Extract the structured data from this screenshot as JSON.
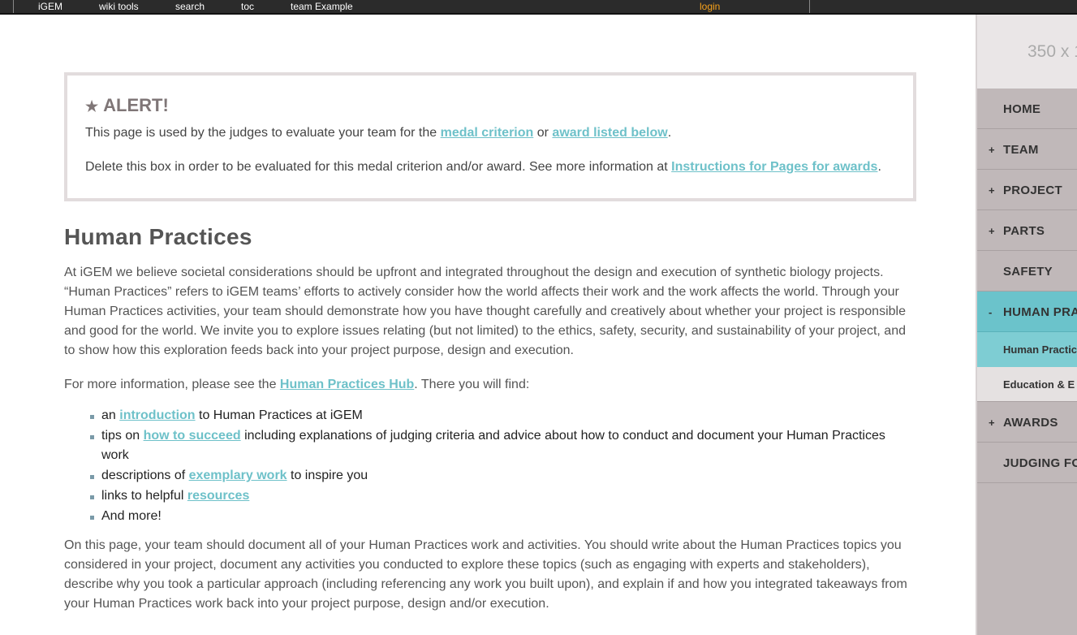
{
  "topbar": {
    "igem": "iGEM",
    "wiki_tools": "wiki tools",
    "search": "search",
    "toc": "toc",
    "team": "team Example",
    "login": "login"
  },
  "sidebar": {
    "logo_placeholder": "350 x 1",
    "items": [
      {
        "sign": "",
        "label": "HOME"
      },
      {
        "sign": "+",
        "label": "TEAM"
      },
      {
        "sign": "+",
        "label": "PROJECT"
      },
      {
        "sign": "+",
        "label": "PARTS"
      },
      {
        "sign": "",
        "label": "SAFETY"
      },
      {
        "sign": "-",
        "label": "HUMAN PRA"
      }
    ],
    "sub_items": [
      "Human Practic",
      "Education & E"
    ],
    "items_after": [
      {
        "sign": "+",
        "label": "AWARDS"
      },
      {
        "sign": "",
        "label": "JUDGING FO"
      }
    ]
  },
  "alert": {
    "star": "★",
    "title": "ALERT!",
    "p1_pre": "This page is used by the judges to evaluate your team for the ",
    "p1_link1": "medal criterion",
    "p1_mid": " or ",
    "p1_link2": "award listed below",
    "p1_post": ".",
    "p2_pre": "Delete this box in order to be evaluated for this medal criterion and/or award. See more information at ",
    "p2_link": "Instructions for Pages for awards",
    "p2_post": "."
  },
  "main": {
    "title": "Human Practices",
    "intro": "At iGEM we believe societal considerations should be upfront and integrated throughout the design and execution of synthetic biology projects. “Human Practices” refers to iGEM teams’ efforts to actively consider how the world affects their work and the work affects the world. Through your Human Practices activities, your team should demonstrate how you have thought carefully and creatively about whether your project is responsible and good for the world. We invite you to explore issues relating (but not limited) to the ethics, safety, security, and sustainability of your project, and to show how this exploration feeds back into your project purpose, design and execution.",
    "more_pre": "For more information, please see the ",
    "more_link": "Human Practices Hub",
    "more_post": ". There you will find:",
    "list": [
      {
        "pre": "an ",
        "link": "introduction",
        "post": " to Human Practices at iGEM"
      },
      {
        "pre": "tips on ",
        "link": "how to succeed",
        "post": " including explanations of judging criteria and advice about how to conduct and document your Human Practices work"
      },
      {
        "pre": "descriptions of ",
        "link": "exemplary work",
        "post": " to inspire you"
      },
      {
        "pre": "links to helpful ",
        "link": "resources",
        "post": ""
      },
      {
        "pre": "And more!",
        "link": "",
        "post": ""
      }
    ],
    "closing": "On this page, your team should document all of your Human Practices work and activities. You should write about the Human Practices topics you considered in your project, document any activities you conducted to explore these topics (such as engaging with experts and stakeholders), describe why you took a particular approach (including referencing any work you built upon), and explain if and how you integrated takeaways from your Human Practices work back into your project purpose, design and/or execution."
  }
}
